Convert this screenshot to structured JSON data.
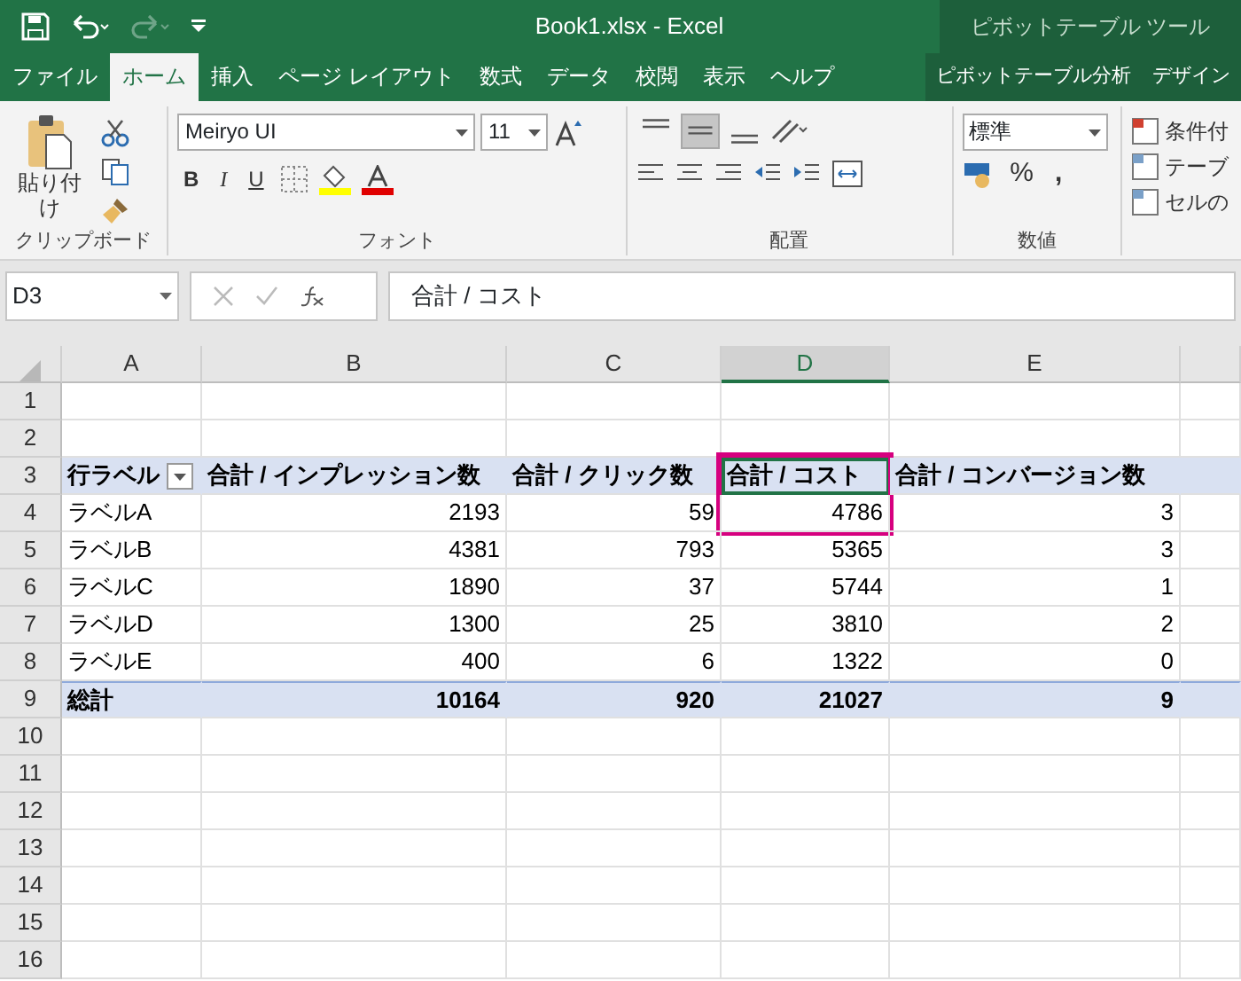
{
  "title_bar": {
    "document_title": "Book1.xlsx  -  Excel",
    "context_group": "ピボットテーブル ツール",
    "redo_disabled": true
  },
  "tabs": [
    {
      "label": "ファイル",
      "selected": false,
      "contextual": false
    },
    {
      "label": "ホーム",
      "selected": true,
      "contextual": false
    },
    {
      "label": "挿入",
      "selected": false,
      "contextual": false
    },
    {
      "label": "ページ レイアウト",
      "selected": false,
      "contextual": false
    },
    {
      "label": "数式",
      "selected": false,
      "contextual": false
    },
    {
      "label": "データ",
      "selected": false,
      "contextual": false
    },
    {
      "label": "校閲",
      "selected": false,
      "contextual": false
    },
    {
      "label": "表示",
      "selected": false,
      "contextual": false
    },
    {
      "label": "ヘルプ",
      "selected": false,
      "contextual": false
    },
    {
      "label": "ピボットテーブル分析",
      "selected": false,
      "contextual": true
    },
    {
      "label": "デザイン",
      "selected": false,
      "contextual": true
    }
  ],
  "ribbon": {
    "clipboard": {
      "paste": "貼り付け",
      "label": "クリップボード"
    },
    "font": {
      "name": "Meiryo UI",
      "size": "11",
      "bold": "B",
      "italic": "I",
      "underline": "U",
      "label": "フォント"
    },
    "alignment": {
      "vertical": [
        {
          "selected": false
        },
        {
          "selected": true
        },
        {
          "selected": false
        }
      ],
      "label": "配置"
    },
    "number": {
      "format": "標準",
      "percent": "%",
      "comma": ",",
      "label": "数値"
    },
    "styles": {
      "items": [
        "条件付",
        "テーブ",
        "セルの"
      ]
    }
  },
  "name_box": "D3",
  "formula": "合計 / コスト",
  "sheet": {
    "columns": [
      {
        "label": "A",
        "selected": false
      },
      {
        "label": "B",
        "selected": false
      },
      {
        "label": "C",
        "selected": false
      },
      {
        "label": "D",
        "selected": true
      },
      {
        "label": "E",
        "selected": false
      }
    ],
    "rows": [
      {
        "number": "1",
        "kind": "empty"
      },
      {
        "number": "2",
        "kind": "empty"
      },
      {
        "number": "3",
        "kind": "header",
        "cells": [
          {
            "text": "行ラベル",
            "filter": true,
            "selected": false,
            "highlight": false
          },
          {
            "text": "合計 / インプレッション数",
            "filter": false,
            "selected": false,
            "highlight": false
          },
          {
            "text": "合計 / クリック数",
            "filter": false,
            "selected": false,
            "highlight": false
          },
          {
            "text": "合計 / コスト",
            "filter": false,
            "selected": true,
            "highlight": true
          },
          {
            "text": "合計 / コンバージョン数",
            "filter": false,
            "selected": false,
            "highlight": false
          }
        ]
      },
      {
        "number": "4",
        "kind": "body",
        "cells": [
          {
            "text": "ラベルA"
          },
          {
            "text": "2193"
          },
          {
            "text": "59"
          },
          {
            "text": "4786"
          },
          {
            "text": "3"
          }
        ]
      },
      {
        "number": "5",
        "kind": "body",
        "cells": [
          {
            "text": "ラベルB"
          },
          {
            "text": "4381"
          },
          {
            "text": "793"
          },
          {
            "text": "5365"
          },
          {
            "text": "3"
          }
        ]
      },
      {
        "number": "6",
        "kind": "body",
        "cells": [
          {
            "text": "ラベルC"
          },
          {
            "text": "1890"
          },
          {
            "text": "37"
          },
          {
            "text": "5744"
          },
          {
            "text": "1"
          }
        ]
      },
      {
        "number": "7",
        "kind": "body",
        "cells": [
          {
            "text": "ラベルD"
          },
          {
            "text": "1300"
          },
          {
            "text": "25"
          },
          {
            "text": "3810"
          },
          {
            "text": "2"
          }
        ]
      },
      {
        "number": "8",
        "kind": "body",
        "cells": [
          {
            "text": "ラベルE"
          },
          {
            "text": "400"
          },
          {
            "text": "6"
          },
          {
            "text": "1322"
          },
          {
            "text": "0"
          }
        ]
      },
      {
        "number": "9",
        "kind": "total",
        "cells": [
          {
            "text": "総計"
          },
          {
            "text": "10164"
          },
          {
            "text": "920"
          },
          {
            "text": "21027"
          },
          {
            "text": "9"
          }
        ]
      },
      {
        "number": "10",
        "kind": "empty"
      },
      {
        "number": "11",
        "kind": "empty"
      },
      {
        "number": "12",
        "kind": "empty"
      },
      {
        "number": "13",
        "kind": "empty"
      },
      {
        "number": "14",
        "kind": "empty"
      },
      {
        "number": "15",
        "kind": "empty"
      },
      {
        "number": "16",
        "kind": "empty"
      }
    ]
  }
}
